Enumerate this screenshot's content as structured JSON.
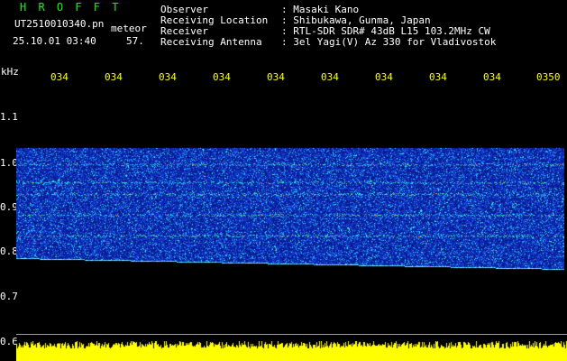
{
  "header": {
    "logo_text": "H R O F F T",
    "filename": "UT2510010340.pn",
    "meteor_label": "meteor",
    "date_time": "25.10.01 03:40",
    "count": "57."
  },
  "info": [
    {
      "label": "Observer",
      "value": ": Masaki Kano"
    },
    {
      "label": "Receiving Location",
      "value": ": Shibukawa, Gunma, Japan"
    },
    {
      "label": "Receiver",
      "value": ": RTL-SDR SDR# 43dB L15 103.2MHz CW"
    },
    {
      "label": "Receiving Antenna",
      "value": ": 3el Yagi(V) Az 330 for Vladivostok"
    }
  ],
  "axis": {
    "unit_label": "kHz",
    "y_labels": [
      "1.1",
      "1.0",
      "0.9",
      "0.8",
      "0.7",
      "0.6"
    ],
    "time_ticks": [
      "034",
      "034",
      "034",
      "034",
      "034",
      "034",
      "034",
      "034",
      "034",
      "0350"
    ]
  },
  "colors": {
    "background": "#000000",
    "text": "#ffffff",
    "ticks": "#ffff00",
    "logo": "#00ff00",
    "spectrum_base": "#0a1fb0",
    "signal_bars": "#ffff00",
    "separator": "#9a9a9a"
  }
}
